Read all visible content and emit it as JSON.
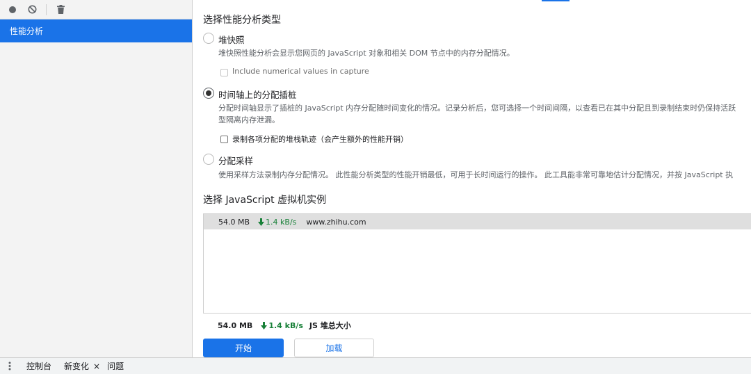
{
  "sidebar": {
    "toolbar": {
      "record_icon": "record-icon",
      "clear_icon": "clear-icon",
      "delete_icon": "trash-icon"
    },
    "items": [
      {
        "label": "性能分析",
        "selected": true
      }
    ]
  },
  "main": {
    "section_profile_type_title": "选择性能分析类型",
    "options": [
      {
        "label": "堆快照",
        "selected": false,
        "description": "堆快照性能分析会显示您网页的 JavaScript 对象和相关 DOM 节点中的内存分配情况。",
        "checkbox": {
          "label": "Include numerical values in capture",
          "checked": false,
          "disabled": true
        }
      },
      {
        "label": "时间轴上的分配插桩",
        "selected": true,
        "description_line1": "分配时间轴显示了插桩的 JavaScript 内存分配随时间变化的情况。记录分析后，您可选择一个时间间隔，以查看已在其中分配且到录制结束时仍保持活跃",
        "description_line2": "型隔离内存泄漏。",
        "checkbox": {
          "label": "录制各项分配的堆栈轨迹（会产生额外的性能开销）",
          "checked": false,
          "disabled": false
        }
      },
      {
        "label": "分配采样",
        "selected": false,
        "description": "使用采样方法录制内存分配情况。 此性能分析类型的性能开销最低，可用于长时间运行的操作。 此工具能非常可靠地估计分配情况，并按 JavaScript 执"
      }
    ],
    "section_vm_title": "选择 JavaScript 虚拟机实例",
    "vm_instances": [
      {
        "size": "54.0 MB",
        "rate": "1.4 kB/s",
        "host": "www.zhihu.com"
      }
    ],
    "summary": {
      "size": "54.0 MB",
      "rate": "1.4 kB/s",
      "label": "JS 堆总大小"
    },
    "start_button": "开始",
    "load_button": "加载"
  },
  "drawer": {
    "menu_icon": "kebab-menu-icon",
    "tabs": [
      {
        "label": "控制台",
        "closable": false
      },
      {
        "label": "新变化",
        "closable": true,
        "close_glyph": "×"
      },
      {
        "label": "问题",
        "closable": false
      }
    ]
  },
  "colors": {
    "accent": "#1a73e8",
    "rate_green": "#188038",
    "sidebar_bg": "#f3f3f3",
    "selected_row_bg": "#dfdfdf"
  }
}
